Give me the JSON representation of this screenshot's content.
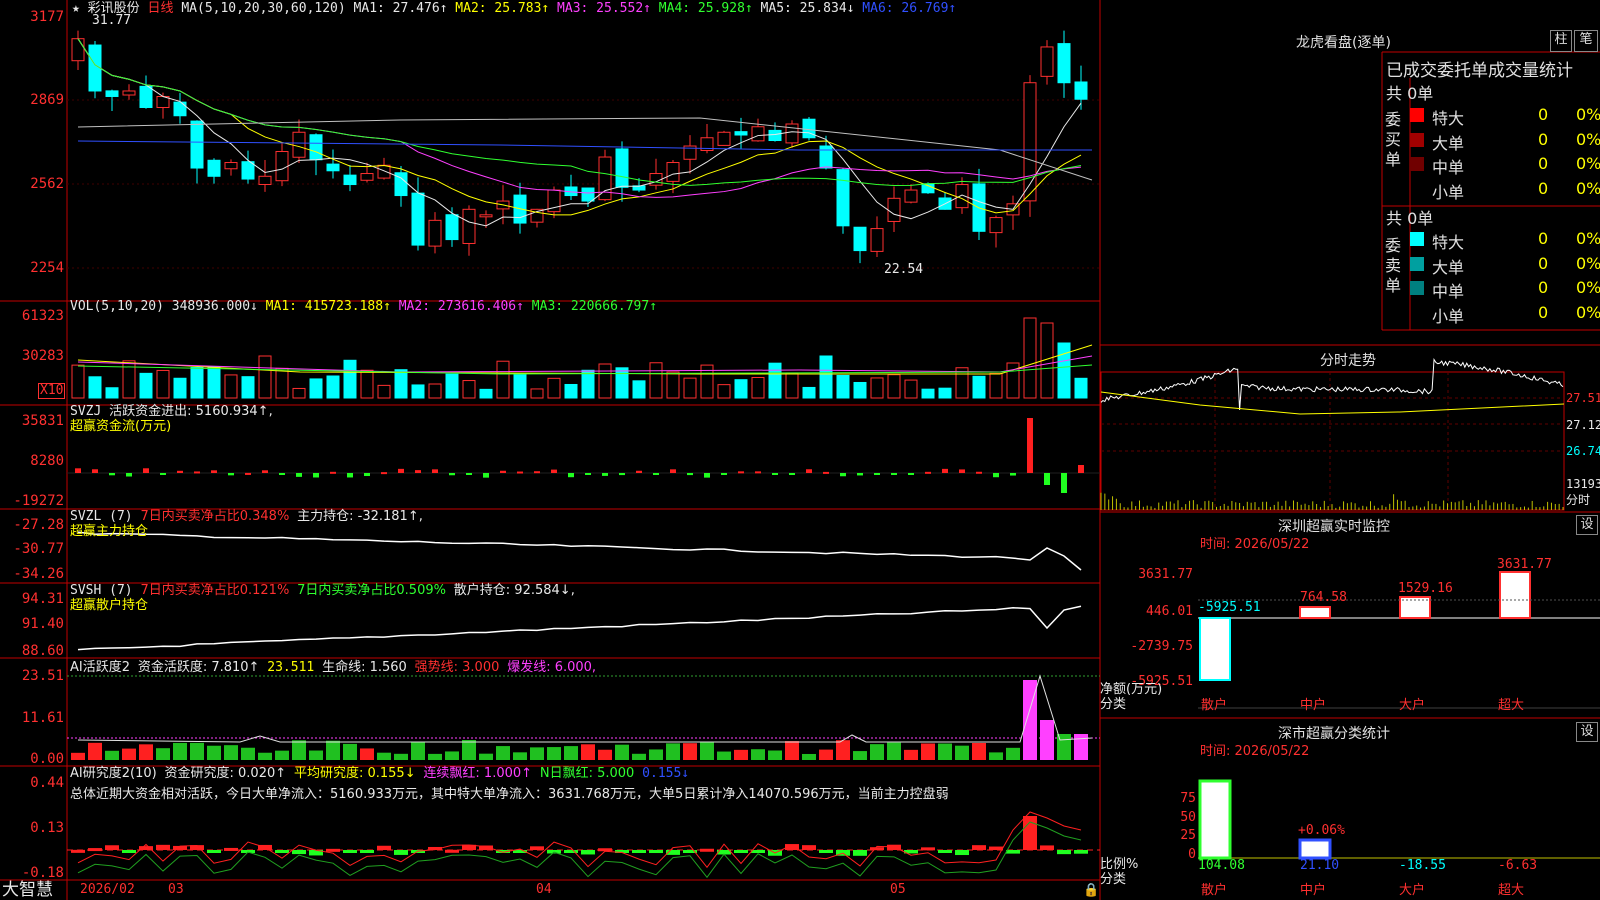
{
  "kline": {
    "header": {
      "star": "★",
      "name": "彩讯股份",
      "period": "日线",
      "ma_params": "MA(5,10,20,30,60,120)",
      "ma1": "MA1: 27.476↑",
      "ma2": "MA2: 25.783↑",
      "ma3": "MA3: 25.552↑",
      "ma4": "MA4: 25.928↑",
      "ma5": "MA5: 25.834↓",
      "ma6": "MA6: 26.769↑"
    },
    "axis": [
      "3177",
      "2869",
      "2562",
      "2254"
    ],
    "high_label": "31.77",
    "low_label": "22.54"
  },
  "vol": {
    "header": {
      "params": "VOL(5,10,20)",
      "value": "348936.000↓",
      "ma1": "MA1: 415723.188↑",
      "ma2": "MA2: 273616.406↑",
      "ma3": "MA3: 220666.797↑"
    },
    "axis": [
      "61323",
      "30283"
    ],
    "unit": "X10"
  },
  "svzj": {
    "header": {
      "name": "SVZJ",
      "item": "活跃资金进出: 5160.934↑,",
      "sub": "超赢资金流(万元)"
    },
    "axis": [
      "35831",
      "8280",
      "-19272"
    ]
  },
  "svzl": {
    "header": {
      "name": "SVZL (7)",
      "item1": "7日内买卖净占比0.348%",
      "item2": "主力持仓: -32.181↑,",
      "sub": "超赢主力持仓"
    },
    "axis": [
      "-27.28",
      "-30.77",
      "-34.26"
    ]
  },
  "svsh": {
    "header": {
      "name": "SVSH (7)",
      "item1": "7日内买卖净占比0.121%",
      "item2": "7日内买卖净占比0.509%",
      "item3": "散户持仓: 92.584↓,",
      "sub": "超赢散户持仓"
    },
    "axis": [
      "94.31",
      "91.40",
      "88.60"
    ]
  },
  "ai1": {
    "header": {
      "name": "AI活跃度2",
      "item1": "资金活跃度: 7.810↑",
      "item2": "23.511",
      "item3": "生命线: 1.560",
      "item4": "强势线: 3.000",
      "item5": "爆发线: 6.000,"
    },
    "axis": [
      "23.51",
      "11.61",
      "0.00"
    ]
  },
  "ai2": {
    "header": {
      "name": "AI研究度2(10)",
      "item1": "资金研究度: 0.020↑",
      "item2": "平均研究度: 0.155↓",
      "item3": "连续飘红: 1.000↑",
      "item4": "N日飘红: 5.000",
      "item5": "0.155↓"
    },
    "summary": "总体近期大资金相对活跃，今日大单净流入：5160.933万元，其中特大单净流入：3631.768万元，大单5日累计净入14070.596万元，当前主力控盘弱",
    "axis": [
      "0.44",
      "0.13",
      "-0.18"
    ]
  },
  "bottom": {
    "brand": "大智慧",
    "dates": [
      "2026/02",
      "03",
      "04",
      "05"
    ]
  },
  "dragon": {
    "title": "龙虎看盘(逐单)",
    "btn1": "柱",
    "btn2": "笔",
    "subtitle": "已成交委托单成交量统计",
    "buy": {
      "label": "委买单",
      "total": "共 0单",
      "rows": [
        {
          "name": "特大",
          "count": "0",
          "pct": "0%",
          "color": "#ff0000"
        },
        {
          "name": "大单",
          "count": "0",
          "pct": "0%",
          "color": "#a00000"
        },
        {
          "name": "中单",
          "count": "0",
          "pct": "0%",
          "color": "#700000"
        },
        {
          "name": "小单",
          "count": "0",
          "pct": "0%",
          "color": ""
        }
      ]
    },
    "sell": {
      "label": "委卖单",
      "total": "共 0单",
      "rows": [
        {
          "name": "特大",
          "count": "0",
          "pct": "0%",
          "color": "#00ffff"
        },
        {
          "name": "大单",
          "count": "0",
          "pct": "0%",
          "color": "#00a0a0"
        },
        {
          "name": "中单",
          "count": "0",
          "pct": "0%",
          "color": "#008080"
        },
        {
          "name": "小单",
          "count": "0",
          "pct": "0%",
          "color": ""
        }
      ]
    }
  },
  "intraday": {
    "title": "分时走势",
    "axis": [
      "27.51",
      "27.12",
      "26.74",
      "13193"
    ],
    "unit": "分时"
  },
  "monitor": {
    "title": "深圳超赢实时监控",
    "btn": "设",
    "time": "时间: 2026/05/22",
    "axis": [
      "3631.77",
      "446.01",
      "-2739.75",
      "-5925.51"
    ],
    "ylabel": "净额(万元)",
    "xlabel": "分类",
    "cats": [
      "散户",
      "中户",
      "大户",
      "超大"
    ],
    "values": [
      "-5925.51",
      "764.58",
      "1529.16",
      "3631.77"
    ]
  },
  "stats": {
    "title": "深市超赢分类统计",
    "btn": "设",
    "time": "时间: 2026/05/22",
    "axis": [
      "75",
      "50",
      "25",
      "0"
    ],
    "ylabel": "比例%",
    "xlabel": "分类",
    "cats": [
      "散户",
      "中户",
      "大户",
      "超大"
    ],
    "values": [
      "104.08",
      "21.10",
      "-18.55",
      "-6.63"
    ],
    "mid_label": "+0.06%"
  }
}
